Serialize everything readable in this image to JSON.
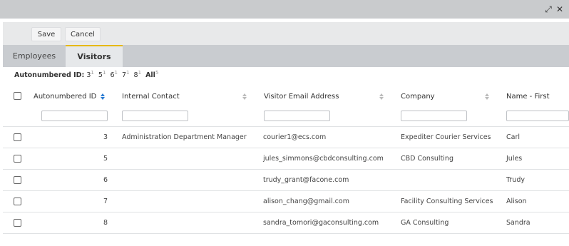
{
  "window": {
    "expand_icon": "expand-arrows-icon",
    "expand_glyph": "⤢",
    "close_icon": "close-icon",
    "close_glyph": "✕"
  },
  "toolbar": {
    "save_label": "Save",
    "cancel_label": "Cancel"
  },
  "tabs": [
    {
      "label": "Employees",
      "active": false
    },
    {
      "label": "Visitors",
      "active": true
    }
  ],
  "filter": {
    "label": "Autonumbered ID:",
    "values": [
      {
        "value": "3",
        "count": "1"
      },
      {
        "value": "5",
        "count": "1"
      },
      {
        "value": "6",
        "count": "1"
      },
      {
        "value": "7",
        "count": "1"
      },
      {
        "value": "8",
        "count": "1"
      }
    ],
    "all_label": "All",
    "all_count": "5"
  },
  "columns": [
    {
      "key": "id",
      "label": "Autonumbered ID",
      "sorted": true
    },
    {
      "key": "contact",
      "label": "Internal Contact",
      "sorted": false
    },
    {
      "key": "email",
      "label": "Visitor Email Address",
      "sorted": false
    },
    {
      "key": "company",
      "label": "Company",
      "sorted": false
    },
    {
      "key": "first",
      "label": "Name - First",
      "sorted": false
    }
  ],
  "rows": [
    {
      "id": "3",
      "contact": "Administration Department Manager",
      "email": "courier1@ecs.com",
      "company": "Expediter Courier Services",
      "first": "Carl"
    },
    {
      "id": "5",
      "contact": "",
      "email": "jules_simmons@cbdconsulting.com",
      "company": "CBD Consulting",
      "first": "Jules"
    },
    {
      "id": "6",
      "contact": "",
      "email": "trudy_grant@facone.com",
      "company": "",
      "first": "Trudy"
    },
    {
      "id": "7",
      "contact": "",
      "email": "alison_chang@gmail.com",
      "company": "Facility Consulting Services",
      "first": "Alison"
    },
    {
      "id": "8",
      "contact": "",
      "email": "sandra_tomori@gaconsulting.com",
      "company": "GA Consulting",
      "first": "Sandra"
    }
  ],
  "colors": {
    "titlebar": "#c9cbcd",
    "toolbar": "#e8e9ea",
    "tabbar": "#c9ccd0",
    "active_tab": "#e6e8ea",
    "active_tab_accent": "#e6b800",
    "sort_active": "#2a7bd2"
  }
}
